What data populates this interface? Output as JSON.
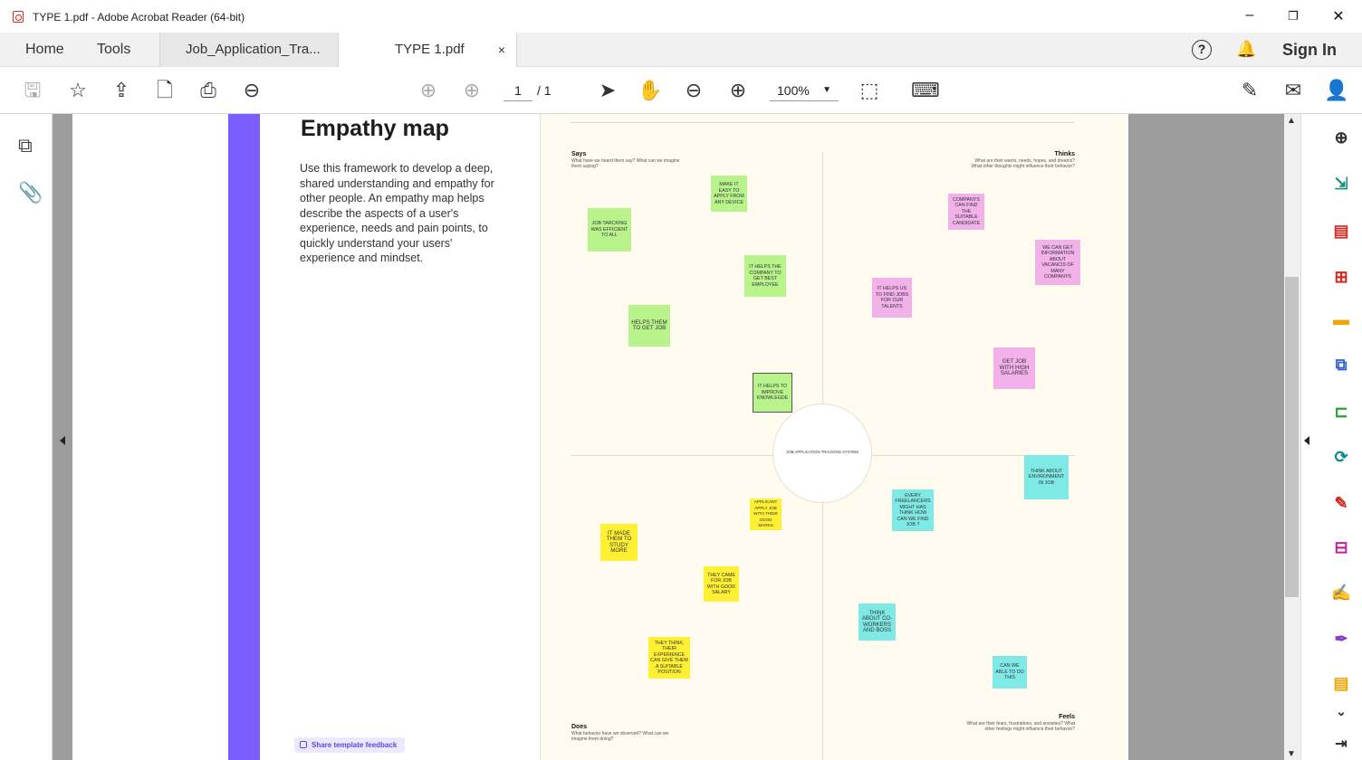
{
  "window": {
    "title": "TYPE 1.pdf - Adobe Acrobat Reader (64-bit)"
  },
  "tabs": {
    "home": "Home",
    "tools": "Tools",
    "doc1": "Job_Application_Tra...",
    "doc2": "TYPE 1.pdf",
    "close": "×",
    "sign_in": "Sign In",
    "help": "?"
  },
  "toolbar": {
    "page_current": "1",
    "page_total": "/ 1",
    "zoom": "100%"
  },
  "page": {
    "heading": "Empathy map",
    "description": "Use this framework to develop a deep, shared understanding and empathy for other people. An empathy map helps describe the aspects of a user's experience, needs and pain points, to quickly understand your users' experience and mindset.",
    "feedback": "Share template feedback"
  },
  "board": {
    "center": "JOB APPLICATION TRACKING SYSTEM",
    "says": {
      "title": "Says",
      "q": "What have we heard them say? What can we imagine them saying?"
    },
    "thinks": {
      "title": "Thinks",
      "q": "What are their wants, needs, hopes, and dreams? What other thoughts might influence their behavior?"
    },
    "does": {
      "title": "Does",
      "q": "What behavior have we observed? What can we imagine them doing?"
    },
    "feels": {
      "title": "Feels",
      "q": "What are their fears, frustrations, and anxieties? What other feelings might influence their behavior?"
    },
    "notes": {
      "n1": "MAKE IT EASY TO APPLY FROM ANY DEVICE",
      "n2": "JOB TARCKING WAS EFFICIENT TO ALL",
      "n3": "IT HELPS THE COMPANY TO GET BEST EMPLOYEE",
      "n4": "HELPS THEM TO GET JOB",
      "n5": "IT HELPS TO IMPROVE KNOWLEGDE",
      "n6": "COMPANYS CAN FIND THE SUITABLE CANDIDATE",
      "n7": "WE CAN GET INFORMATION ABOUT VACANCIS OF MANY COMPANYS",
      "n8": "IT HELPS US TO FIND JOBS FOR OUR TALENTS",
      "n9": "GET JOB WITH HIGH SALARIES",
      "n10": "APPLICANT APPLY JOB WITH THEIR GOOD MARKS",
      "n11": "IT MADE THEM TO STUDY MORE",
      "n12": "THEY CAME FOR JOB WITH GOOD SALARY",
      "n13": "THEY THINK, THEIR EXPERIENCE CAN GIVE THEM A SUITABLE POSITION",
      "n14": "THINK ABOUT ENVIRONMENT IN JOB",
      "n15": "EVERY FREELANCERS MIGHT HAS THINK HOW CAN WE FIND JOB ?",
      "n16": "THINK ABOUT CO-WORKERS AND BOSS",
      "n17": "CAN WE ABLE TO DO THIS"
    }
  }
}
